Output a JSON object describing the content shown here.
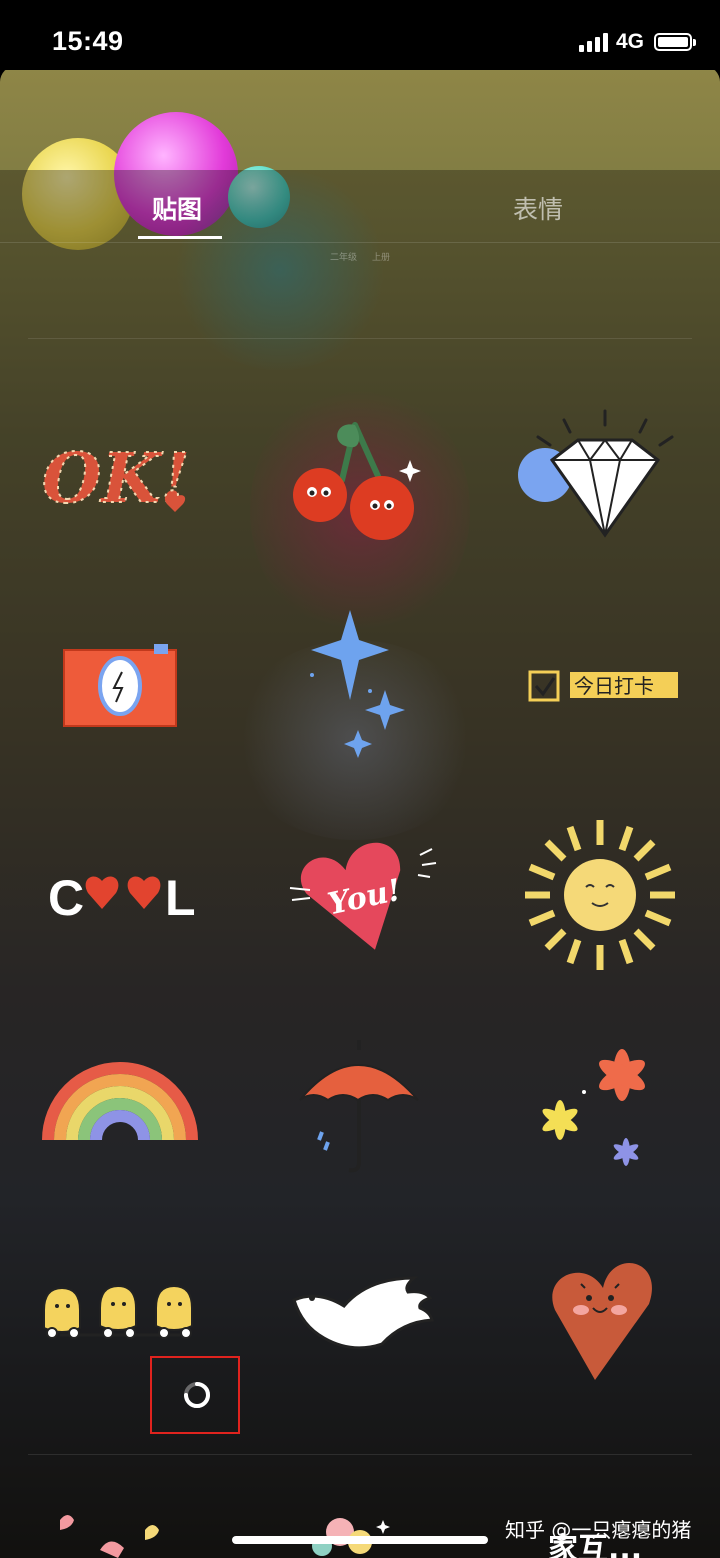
{
  "status_bar": {
    "time": "15:49",
    "network": "4G",
    "battery_percent": 100
  },
  "tabs": [
    {
      "label": "贴图",
      "active": true
    },
    {
      "label": "表情",
      "active": false
    }
  ],
  "faint_labels": [
    "二年级",
    "上册"
  ],
  "stickers": [
    {
      "name": "ok-sticker",
      "text": "OK!"
    },
    {
      "name": "cherries-sticker"
    },
    {
      "name": "diamond-sticker"
    },
    {
      "name": "camera-sticker"
    },
    {
      "name": "sparkle-stars-sticker"
    },
    {
      "name": "daily-checkin-sticker",
      "text": "今日打卡"
    },
    {
      "name": "cool-hearts-sticker",
      "text": "C♥♥L"
    },
    {
      "name": "you-heart-sticker",
      "text": "You!"
    },
    {
      "name": "sun-sticker"
    },
    {
      "name": "rainbow-sticker"
    },
    {
      "name": "umbrella-sticker"
    },
    {
      "name": "flowers-sticker"
    },
    {
      "name": "chicks-sticker"
    },
    {
      "name": "dove-sticker"
    },
    {
      "name": "smiling-heart-sticker"
    }
  ],
  "bottom_partial_text": "家互...",
  "watermark": "知乎 @一只瘪瘪的猪",
  "colors": {
    "highlight_box": "#e0231e",
    "accent_red": "#e2442f"
  }
}
